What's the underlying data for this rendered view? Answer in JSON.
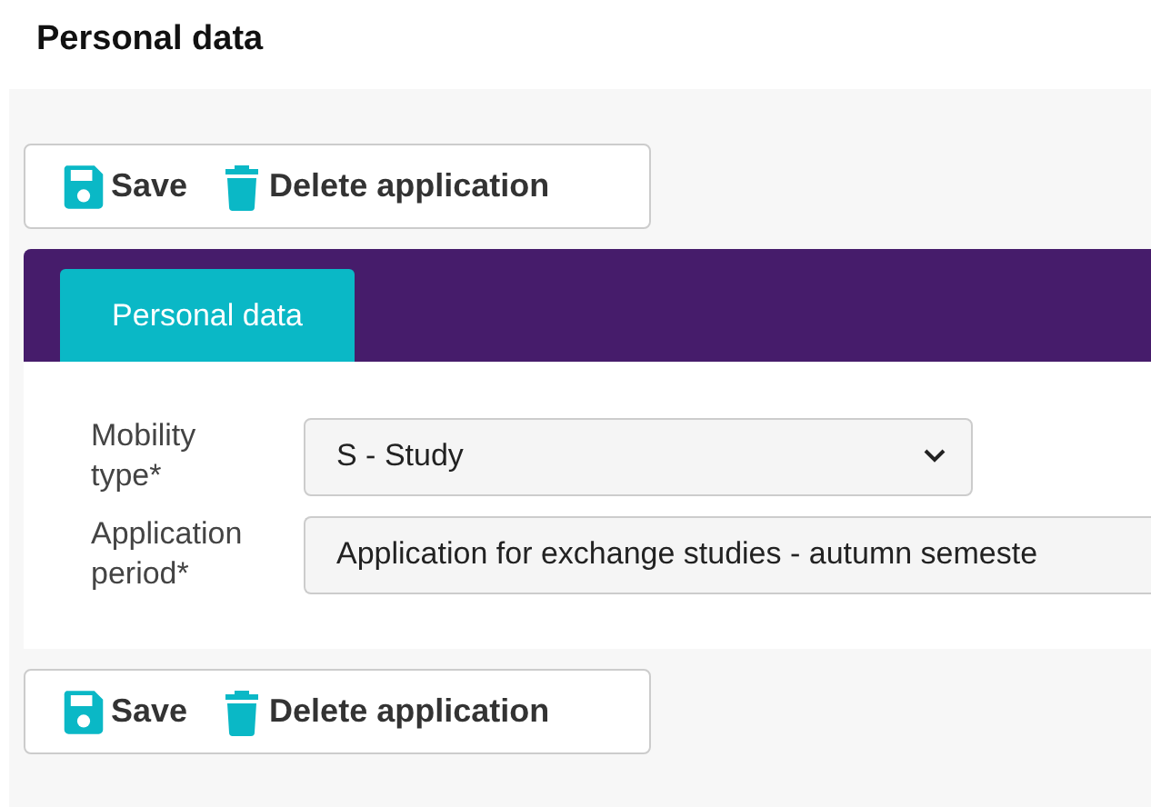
{
  "heading": "Personal data",
  "toolbar_top": [
    {
      "kind": "save",
      "label": "Save"
    },
    {
      "kind": "delete",
      "label": "Delete application"
    }
  ],
  "tabs": [
    {
      "label": "Personal data",
      "selected": true
    }
  ],
  "fields": [
    {
      "kind": "select",
      "label": "Mobility type*",
      "value": "S - Study"
    },
    {
      "kind": "text",
      "label": "Application period*",
      "value": "Application for exchange studies - autumn semeste"
    }
  ],
  "toolbar_bottom": [
    {
      "kind": "save",
      "label": "Save"
    },
    {
      "kind": "delete",
      "label": "Delete application"
    }
  ]
}
